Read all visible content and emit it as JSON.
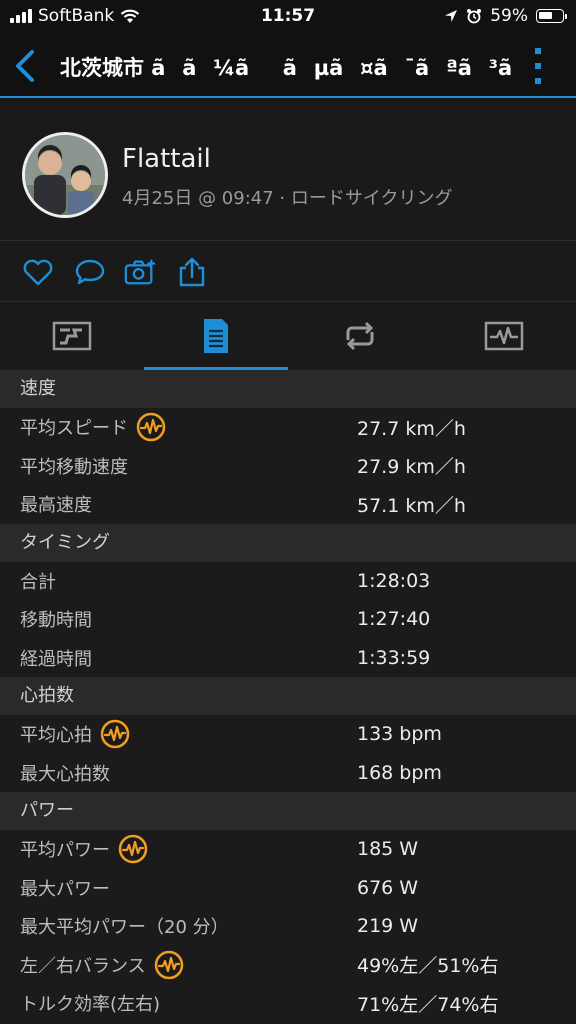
{
  "status": {
    "carrier": "SoftBank",
    "time": "11:57",
    "battery": "59%",
    "battery_level": 0.59
  },
  "header": {
    "title": "北茨城市 ã­ã¼ããµã¤ã¯ãªã³ã°"
  },
  "profile": {
    "name": "Flattail",
    "subtitle": "4月25日 @ 09:47 · ロードサイクリング"
  },
  "icons": {
    "back": "chevron-left-icon",
    "more": "more-vertical-icon",
    "like": "heart-icon",
    "comment": "comment-icon",
    "camera": "camera-add-icon",
    "share": "share-icon",
    "tabs": [
      "overview-icon",
      "details-icon",
      "laps-icon",
      "chart-icon"
    ]
  },
  "colors": {
    "accent": "#1e8fd6",
    "badge": "#f29d1f"
  },
  "sections": [
    {
      "title": "速度",
      "rows": [
        {
          "label": "平均スピード",
          "value": "27.7 km／h",
          "badge": true
        },
        {
          "label": "平均移動速度",
          "value": "27.9 km／h",
          "badge": false
        },
        {
          "label": "最高速度",
          "value": "57.1 km／h",
          "badge": false
        }
      ]
    },
    {
      "title": "タイミング",
      "rows": [
        {
          "label": "合計",
          "value": "1:28:03",
          "badge": false
        },
        {
          "label": "移動時間",
          "value": "1:27:40",
          "badge": false
        },
        {
          "label": "経過時間",
          "value": "1:33:59",
          "badge": false
        }
      ]
    },
    {
      "title": "心拍数",
      "rows": [
        {
          "label": "平均心拍",
          "value": "133 bpm",
          "badge": true
        },
        {
          "label": "最大心拍数",
          "value": "168 bpm",
          "badge": false
        }
      ]
    },
    {
      "title": "パワー",
      "rows": [
        {
          "label": "平均パワー",
          "value": "185 W",
          "badge": true
        },
        {
          "label": "最大パワー",
          "value": "676 W",
          "badge": false
        },
        {
          "label": "最大平均パワー（20 分）",
          "value": "219 W",
          "badge": false
        },
        {
          "label": "左／右バランス",
          "value": "49%左／51%右",
          "badge": true
        },
        {
          "label": "トルク効率(左右)",
          "value": "71%左／74%右",
          "badge": false
        }
      ]
    }
  ]
}
